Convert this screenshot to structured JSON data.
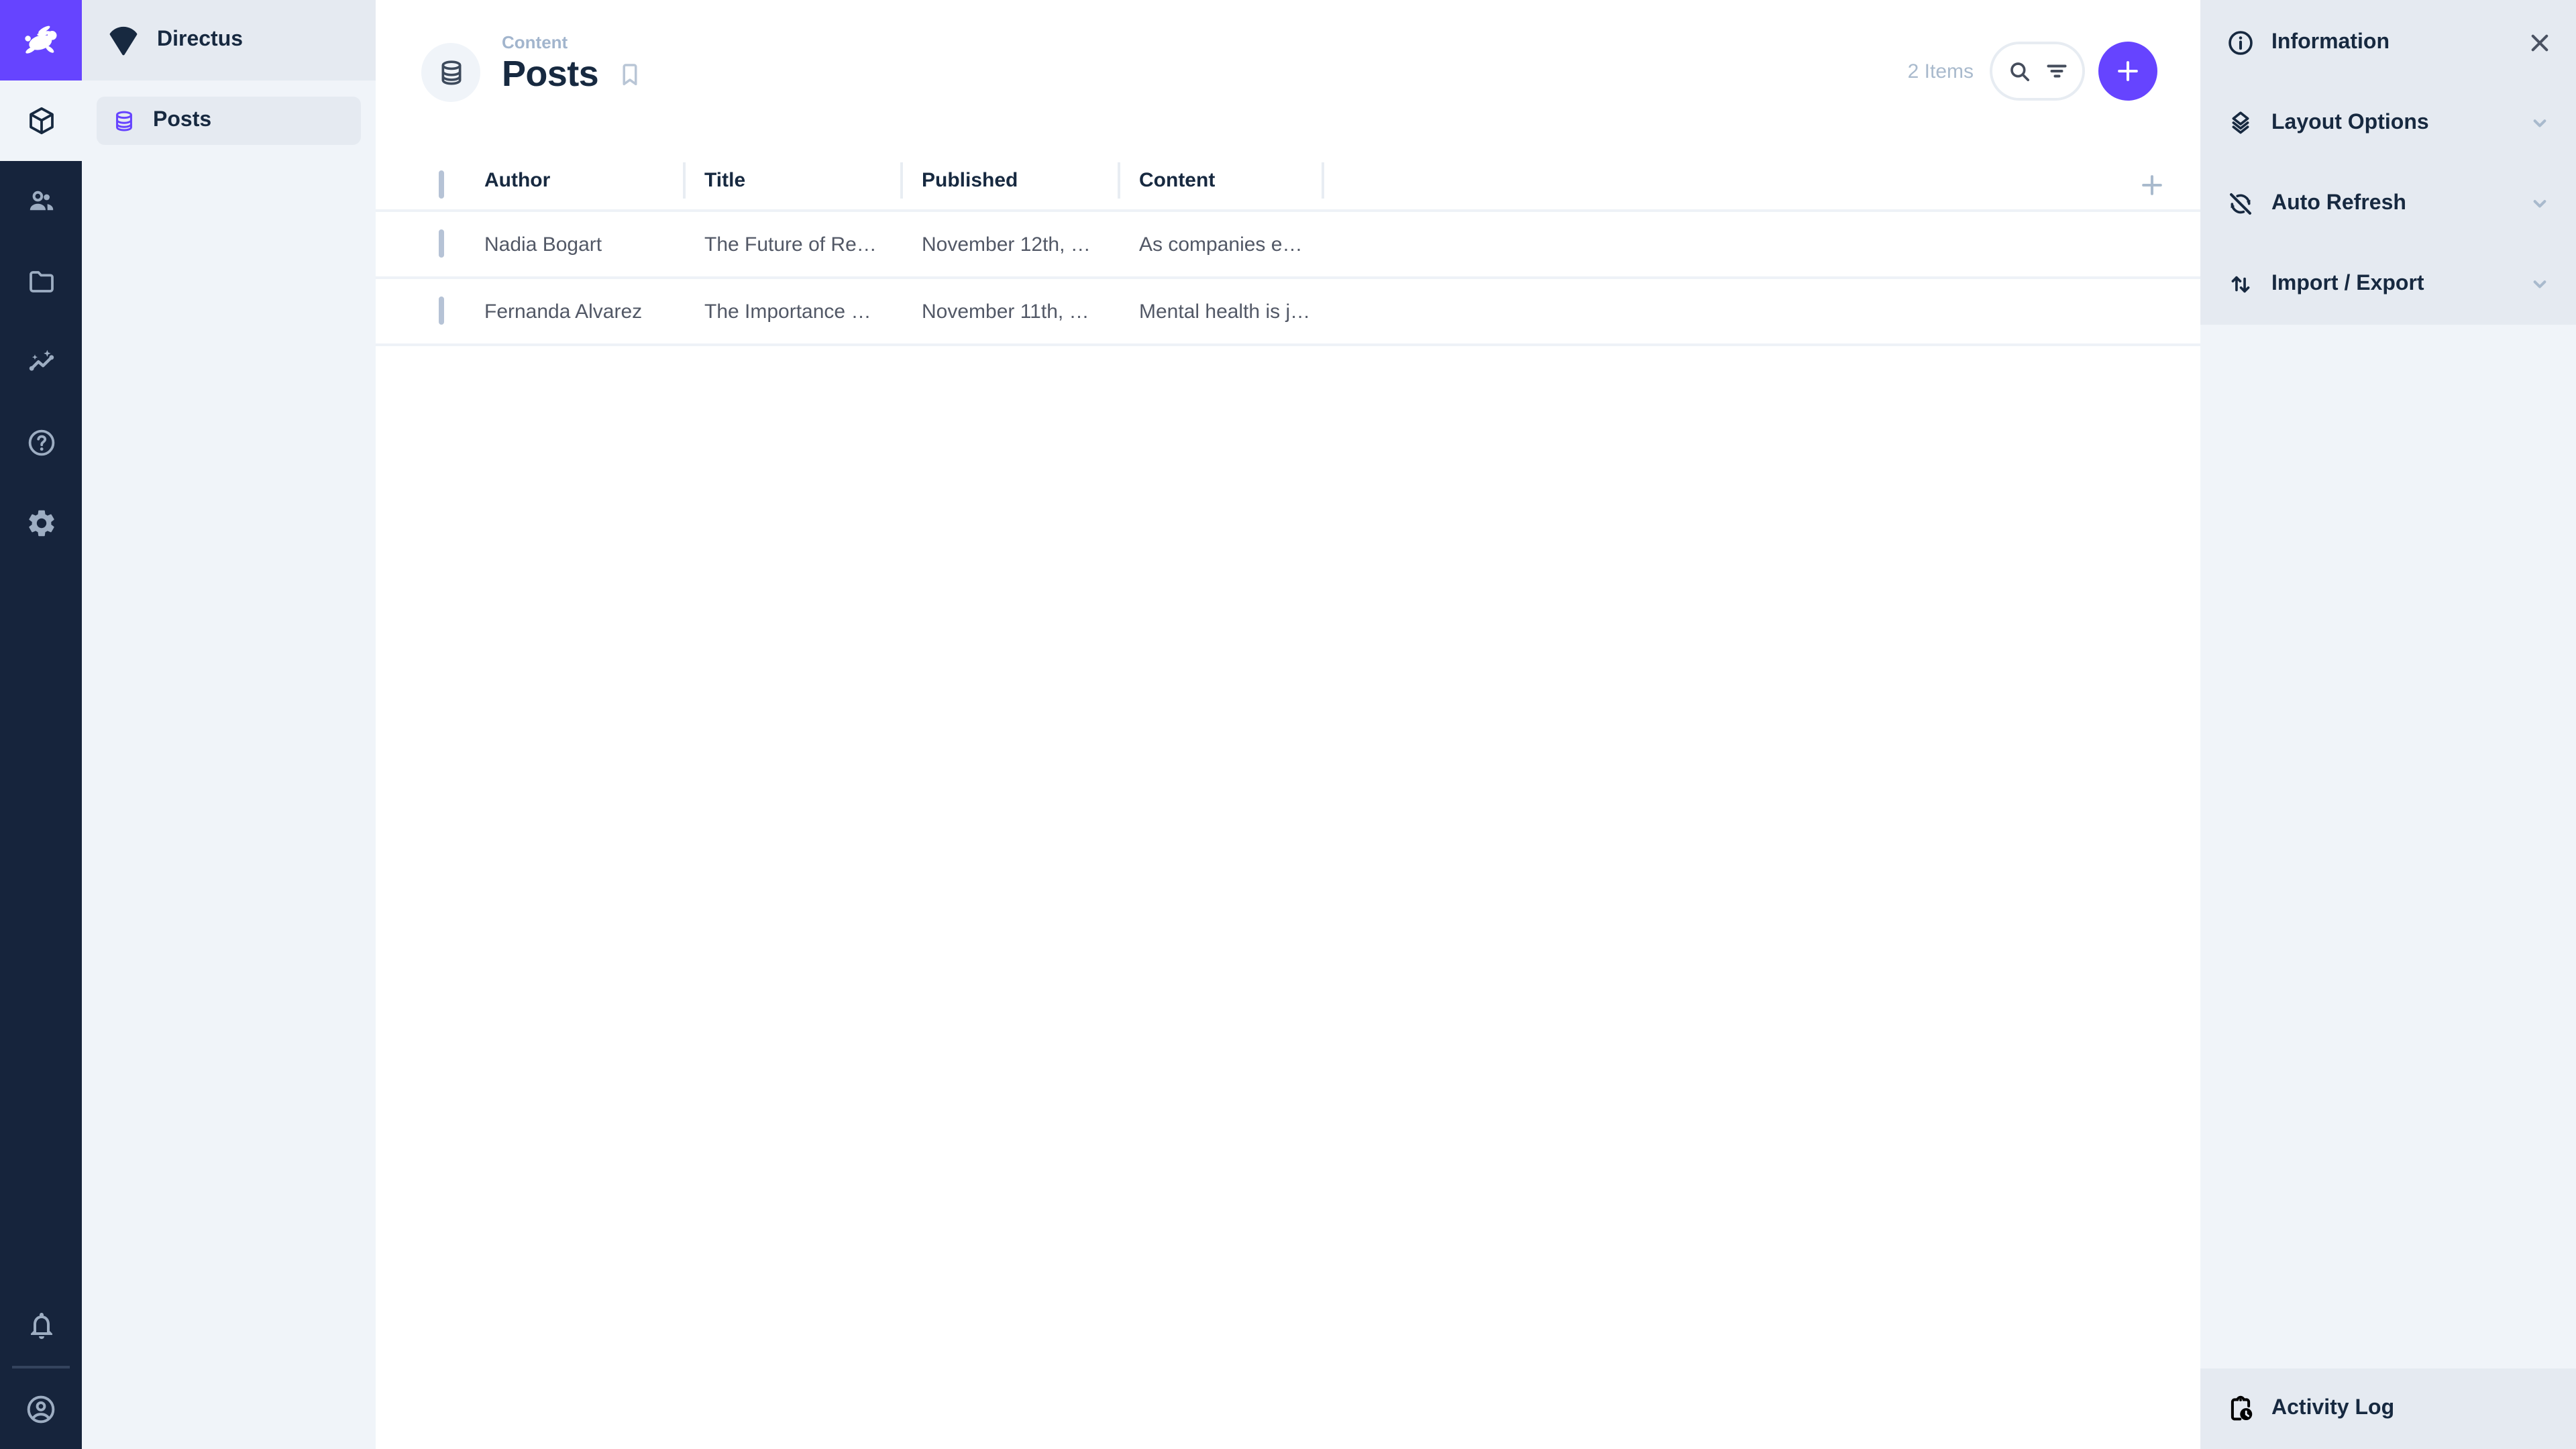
{
  "colors": {
    "primary": "#6644ff",
    "module_bar_bg": "#16243c",
    "heading_text": "#172940",
    "body_text": "#525866",
    "subdued_text": "#a2b5cd",
    "surface": "#f0f4f9",
    "surface_accent": "#e5eaf1",
    "border": "#e4eaf1"
  },
  "module_bar": {
    "logo_icon": "rabbit-icon",
    "modules": [
      {
        "name": "content",
        "icon": "box-icon",
        "active": true
      },
      {
        "name": "users",
        "icon": "people-icon",
        "active": false
      },
      {
        "name": "files",
        "icon": "folder-icon",
        "active": false
      },
      {
        "name": "insights",
        "icon": "insights-icon",
        "active": false
      },
      {
        "name": "help",
        "icon": "help-icon",
        "active": false
      },
      {
        "name": "settings",
        "icon": "gear-icon",
        "active": false
      }
    ],
    "bottom": [
      {
        "name": "notifications",
        "icon": "bell-icon"
      },
      {
        "name": "account",
        "icon": "avatar-icon"
      }
    ]
  },
  "nav": {
    "project_name": "Directus",
    "project_icon": "fan-logo-icon",
    "items": [
      {
        "label": "Posts",
        "icon": "database-icon",
        "active": true
      }
    ]
  },
  "page": {
    "breadcrumb": "Content",
    "title": "Posts",
    "collection_icon": "database-icon",
    "item_count": "2 Items"
  },
  "table": {
    "headers": {
      "author": "Author",
      "title": "Title",
      "published": "Published",
      "content": "Content"
    },
    "rows": [
      {
        "author": "Nadia Bogart",
        "title": "The Future of Re…",
        "published": "November 12th, …",
        "content": "As companies e…"
      },
      {
        "author": "Fernanda Alvarez",
        "title": "The Importance …",
        "published": "November 11th, …",
        "content": "Mental health is j…"
      }
    ]
  },
  "sidebar": {
    "sections": [
      {
        "label": "Information",
        "icon": "info-icon",
        "trailing": "close-icon"
      },
      {
        "label": "Layout Options",
        "icon": "layers-icon",
        "trailing": "chevron-down-icon"
      },
      {
        "label": "Auto Refresh",
        "icon": "sync-disabled-icon",
        "trailing": "chevron-down-icon"
      },
      {
        "label": "Import / Export",
        "icon": "import-export-icon",
        "trailing": "chevron-down-icon"
      }
    ],
    "activity": {
      "label": "Activity Log",
      "icon": "clipboard-clock-icon"
    }
  }
}
